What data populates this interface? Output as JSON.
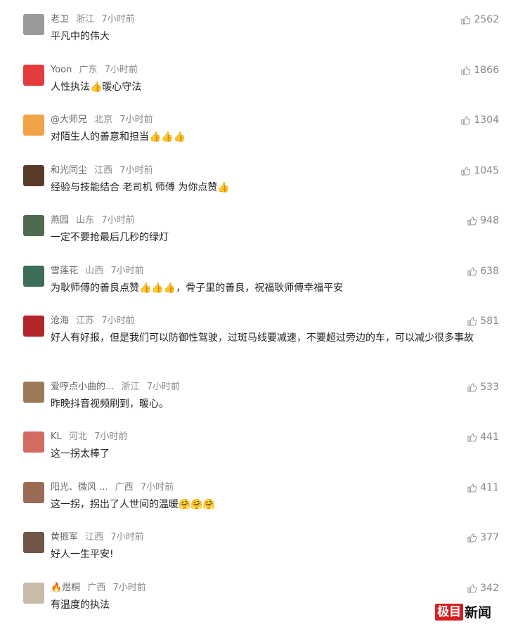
{
  "comments": [
    {
      "nick": "老卫",
      "region": "浙江",
      "time": "7小时前",
      "likes": "2562",
      "text": "平凡中的伟大",
      "emojis": "",
      "avatar_color": "#9a9a9a"
    },
    {
      "nick": "Yoon",
      "region": "广东",
      "time": "7小时前",
      "likes": "1866",
      "text": "人性执法👍暖心守法",
      "emojis": "",
      "avatar_color": "#e23c3c"
    },
    {
      "nick": "@大师兄",
      "region": "北京",
      "time": "7小时前",
      "likes": "1304",
      "text": "对陌生人的善意和担当👍👍👍",
      "emojis": "",
      "avatar_color": "#f1a347"
    },
    {
      "nick": "和光同尘",
      "region": "江西",
      "time": "7小时前",
      "likes": "1045",
      "text": "经验与技能结合 老司机 师傅 为你点赞👍",
      "emojis": "",
      "avatar_color": "#5a3b2a"
    },
    {
      "nick": "燕园",
      "region": "山东",
      "time": "7小时前",
      "likes": "948",
      "text": "一定不要抢最后几秒的绿灯",
      "emojis": "",
      "avatar_color": "#4f6b4f"
    },
    {
      "nick": "雪莲花",
      "region": "山西",
      "time": "7小时前",
      "likes": "638",
      "text": "为耿师傅的善良点赞👍👍👍，骨子里的善良，祝福耿师傅幸福平安",
      "emojis": "",
      "avatar_color": "#3d6e58"
    },
    {
      "nick": "沧海",
      "region": "江苏",
      "time": "7小时前",
      "likes": "581",
      "text": "好人有好报，但是我们可以防御性驾驶，过斑马线要减速，不要超过旁边的车，可以减少很多事故",
      "emojis": "",
      "avatar_color": "#b2252b"
    },
    {
      "nick": "爱哼点小曲的...",
      "region": "浙江",
      "time": "7小时前",
      "likes": "533",
      "text": "昨晚抖音视频刷到，暖心。",
      "emojis": "",
      "avatar_color": "#9b7a5a"
    },
    {
      "nick": "KL",
      "region": "河北",
      "time": "7小时前",
      "likes": "441",
      "text": "这一拐太棒了",
      "emojis": "",
      "avatar_color": "#d36b63"
    },
    {
      "nick": "阳光、微风 ...",
      "region": "广西",
      "time": "7小时前",
      "likes": "411",
      "text": "这一拐，拐出了人世间的温暖🤗🤗🤗",
      "emojis": "",
      "avatar_color": "#9a6b55"
    },
    {
      "nick": "黄振军",
      "region": "江西",
      "time": "7小时前",
      "likes": "377",
      "text": "好人一生平安!",
      "emojis": "",
      "avatar_color": "#6f5646"
    },
    {
      "nick": "🔥煜桐",
      "region": "广西",
      "time": "7小时前",
      "likes": "342",
      "text": "有温度的执法",
      "emojis": "",
      "avatar_color": "#c9bba7"
    }
  ],
  "watermark": {
    "box": "极目",
    "text": "新闻"
  },
  "colors": {
    "meta": "#888888",
    "text": "#222222",
    "brand_red": "#d81e1e"
  }
}
